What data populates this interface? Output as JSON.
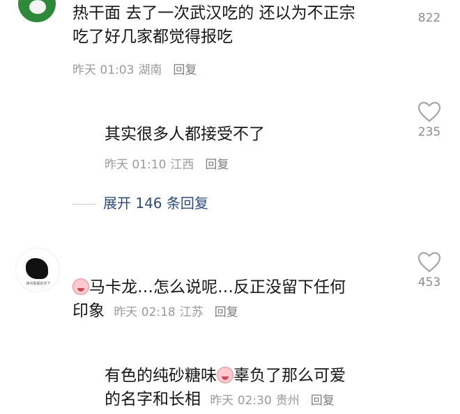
{
  "comments": [
    {
      "text_line1": "热干面 去了一次武汉吃的 还以为不正宗",
      "text_line2": "吃了好几家都觉得报吃",
      "time": "昨天 01:03",
      "location": "湖南",
      "reply": "回复",
      "likes": "822"
    },
    {
      "text_line1": "其实很多人都接受不了",
      "time": "昨天 01:10",
      "location": "江西",
      "reply": "回复",
      "likes": "235"
    },
    {
      "text_prefix": "马卡龙…怎么说呢…反正没留下任何",
      "text_line2": "印象",
      "time": "昨天 02:18",
      "location": "江苏",
      "reply": "回复",
      "likes": "453",
      "avatar_caption": "读书看报好天下"
    },
    {
      "text_part1": "有色的纯砂糖味",
      "text_part2": "辜负了那么可爱",
      "text_line2": "的名字和长相",
      "time": "昨天 02:30",
      "location": "贵州",
      "reply": "回复"
    }
  ],
  "expand": {
    "label": "展开 146 条回复"
  },
  "icons": {
    "like": "heart-outline-icon",
    "emoji": "crying-face-emoji-icon"
  },
  "colors": {
    "text": "#161616",
    "meta": "#9a9a9a",
    "expand": "#2c4a7a",
    "heart": "#a6a6a6"
  }
}
